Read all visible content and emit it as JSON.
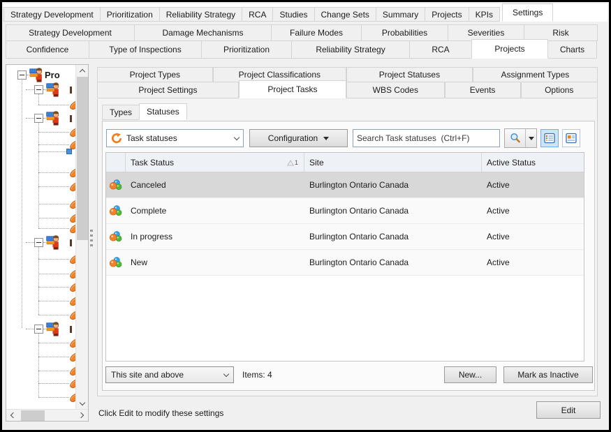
{
  "main_tabs": {
    "items": [
      "Strategy Development",
      "Prioritization",
      "Reliability Strategy",
      "RCA",
      "Studies",
      "Change Sets",
      "Summary",
      "Projects",
      "KPIs",
      "Settings"
    ],
    "selected": "Settings"
  },
  "settings_tabs": {
    "row1": [
      "Strategy Development",
      "Damage Mechanisms",
      "Failure Modes",
      "Probabilities",
      "Severities",
      "Risk"
    ],
    "row2": [
      "Confidence",
      "Type of Inspections",
      "Prioritization",
      "Reliability Strategy",
      "RCA",
      "Projects",
      "Charts"
    ],
    "selected": "Projects"
  },
  "projects_tabs": {
    "row1": [
      "Project Types",
      "Project Classifications",
      "Project Statuses",
      "Assignment Types"
    ],
    "row2": [
      "Project Settings",
      "Project Tasks",
      "WBS Codes",
      "Events",
      "Options"
    ],
    "selected": "Project Tasks"
  },
  "view_tabs": {
    "items": [
      "Types",
      "Statuses"
    ],
    "selected": "Statuses"
  },
  "tree": {
    "root_label": "Pro"
  },
  "toolbar": {
    "entity": "Task statuses",
    "configuration": "Configuration",
    "search_placeholder": "Search Task statuses  (Ctrl+F)"
  },
  "table": {
    "columns": {
      "status": "Task Status",
      "site": "Site",
      "active": "Active Status"
    },
    "sort_badge": "1",
    "rows": [
      {
        "status": "Canceled",
        "site": "Burlington Ontario Canada",
        "active": "Active",
        "selected": true
      },
      {
        "status": "Complete",
        "site": "Burlington Ontario Canada",
        "active": "Active",
        "selected": false
      },
      {
        "status": "In progress",
        "site": "Burlington Ontario Canada",
        "active": "Active",
        "selected": false
      },
      {
        "status": "New",
        "site": "Burlington Ontario Canada",
        "active": "Active",
        "selected": false
      }
    ]
  },
  "footer": {
    "scope": "This site and above",
    "items": "Items: 4",
    "new": "New...",
    "mark_inactive": "Mark as Inactive"
  },
  "status_bar": {
    "message": "Click Edit to modify these settings",
    "edit": "Edit"
  },
  "colors": {
    "accent_orange": "#ef7f1a",
    "selection_gray": "#d8d8d8",
    "view_selected_blue": "#cfe4f8"
  }
}
